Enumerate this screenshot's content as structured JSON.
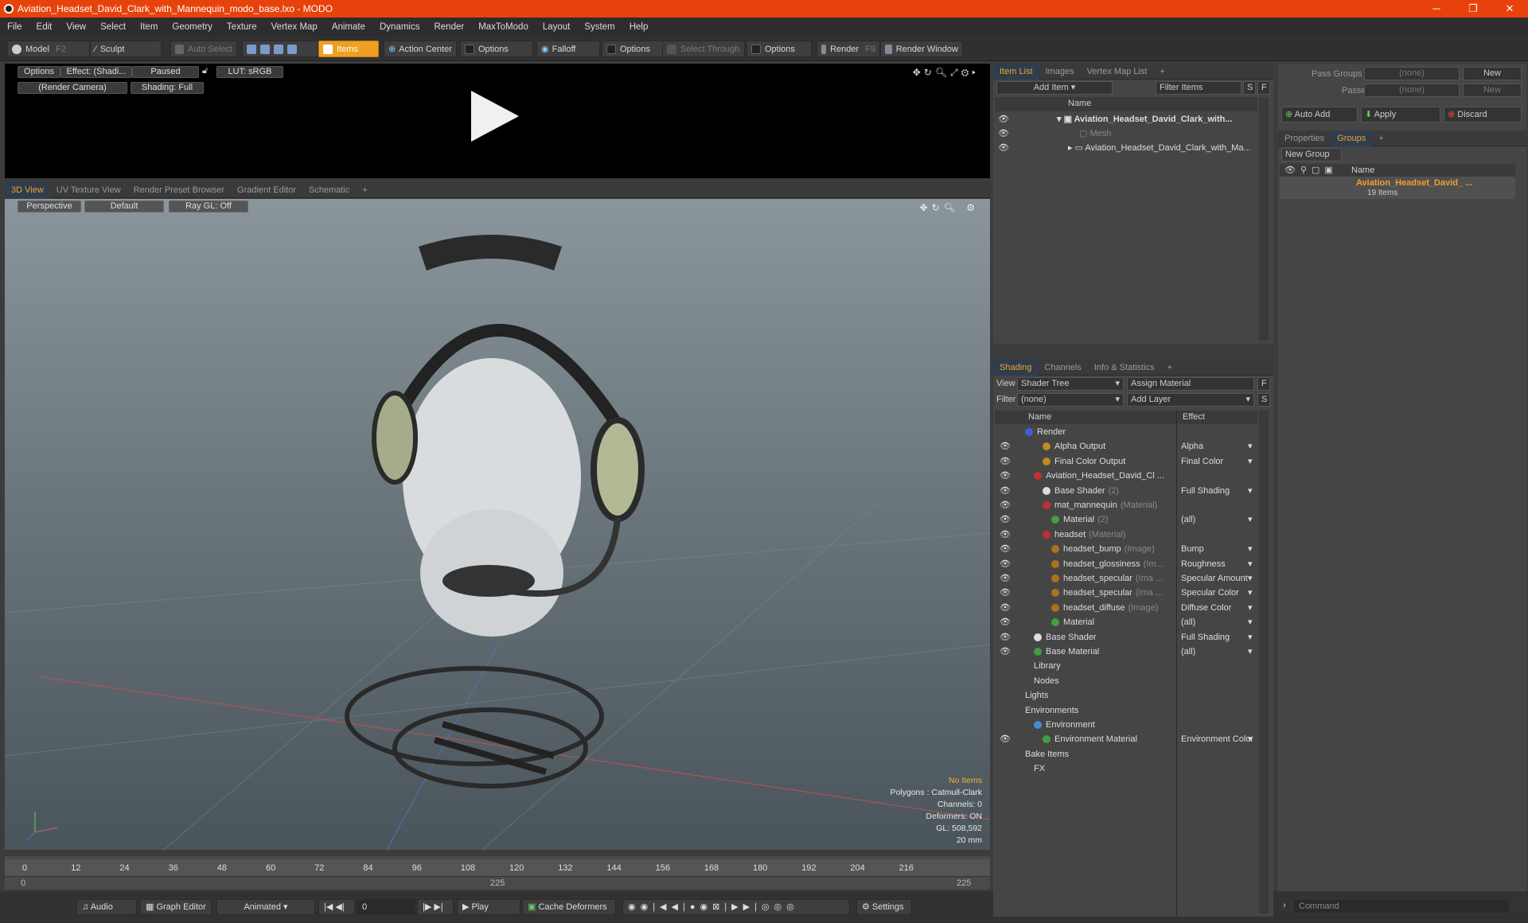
{
  "window": {
    "title": "Aviation_Headset_David_Clark_with_Mannequin_modo_base.lxo - MODO",
    "min": "─",
    "max": "❐",
    "close": "✕"
  },
  "menu": [
    "File",
    "Edit",
    "View",
    "Select",
    "Item",
    "Geometry",
    "Texture",
    "Vertex Map",
    "Animate",
    "Dynamics",
    "Render",
    "MaxToModo",
    "Layout",
    "System",
    "Help"
  ],
  "toolbar": {
    "model": "Model",
    "model_key": "F2",
    "sculpt": "Sculpt",
    "auto_select": "Auto Select",
    "items": "Items",
    "action_center": "Action Center",
    "options1": "Options",
    "falloff": "Falloff",
    "options2": "Options",
    "select_through": "Select Through",
    "options3": "Options",
    "render": "Render",
    "render_key": "F9",
    "render_window": "Render Window"
  },
  "preview": {
    "options": "Options",
    "effect": "Effect: (Shadi...",
    "paused": "Paused",
    "lut": "LUT: sRGB",
    "camera": "(Render Camera)",
    "shading": "Shading: Full"
  },
  "viewtabs": [
    "3D View",
    "UV Texture View",
    "Render Preset Browser",
    "Gradient Editor",
    "Schematic",
    "+"
  ],
  "viewport": {
    "perspective": "Perspective",
    "default": "Default",
    "raygl": "Ray GL: Off",
    "hud": {
      "no_items": "No Items",
      "polygons": "Polygons : Catmull-Clark",
      "channels": "Channels: 0",
      "deformers": "Deformers: ON",
      "gl": "GL: 508,592",
      "mm": "20 mm"
    }
  },
  "timeline": {
    "ticks": [
      "0",
      "12",
      "24",
      "36",
      "48",
      "60",
      "72",
      "84",
      "96",
      "108",
      "120",
      "132",
      "144",
      "156",
      "168",
      "180",
      "192",
      "204",
      "216"
    ],
    "start": "0",
    "mid": "225",
    "end": "225"
  },
  "bottom": {
    "audio": "Audio",
    "graph_editor": "Graph Editor",
    "animated": "Animated",
    "frame": "0",
    "play": "Play",
    "cache": "Cache Deformers",
    "settings": "Settings"
  },
  "itemlist": {
    "tabs": [
      "Item List",
      "Images",
      "Vertex Map List",
      "+"
    ],
    "add_item": "Add Item",
    "filter": "Filter Items",
    "s": "S",
    "f": "F",
    "col_name": "Name",
    "rows": [
      "Aviation_Headset_David_Clark_with...",
      "Mesh",
      "Aviation_Headset_David_Clark_with_Ma..."
    ]
  },
  "shading": {
    "tabs": [
      "Shading",
      "Channels",
      "Info & Statistics",
      "+"
    ],
    "view_label": "View",
    "view_value": "Shader Tree",
    "assign": "Assign Material",
    "f": "F",
    "filter_label": "Filter",
    "filter_value": "(none)",
    "add_layer": "Add Layer",
    "s": "S",
    "col_name": "Name",
    "col_effect": "Effect",
    "rows": [
      {
        "name": "Render",
        "sub": "",
        "effect": "",
        "indent": 0,
        "eye": false,
        "dot": "#4a5ad0"
      },
      {
        "name": "Alpha Output",
        "sub": "",
        "effect": "Alpha",
        "indent": 2,
        "eye": true,
        "dot": "#c08a20"
      },
      {
        "name": "Final Color Output",
        "sub": "",
        "effect": "Final Color",
        "indent": 2,
        "eye": true,
        "dot": "#c08a20"
      },
      {
        "name": "Aviation_Headset_David_Cl ...",
        "sub": "",
        "effect": "",
        "indent": 1,
        "eye": true,
        "dot": "#c03030"
      },
      {
        "name": "Base Shader",
        "sub": "(2)",
        "effect": "Full Shading",
        "indent": 2,
        "eye": true,
        "dot": "#dddddd"
      },
      {
        "name": "mat_mannequin",
        "sub": "(Material)",
        "effect": "",
        "indent": 2,
        "eye": true,
        "dot": "#c03030"
      },
      {
        "name": "Material",
        "sub": "(2)",
        "effect": "(all)",
        "indent": 3,
        "eye": true,
        "dot": "#40a040"
      },
      {
        "name": "headset",
        "sub": "(Material)",
        "effect": "",
        "indent": 2,
        "eye": true,
        "dot": "#c03030"
      },
      {
        "name": "headset_bump",
        "sub": "(Image)",
        "effect": "Bump",
        "indent": 3,
        "eye": true,
        "dot": "#b07020"
      },
      {
        "name": "headset_glossiness",
        "sub": "(Im...",
        "effect": "Roughness",
        "indent": 3,
        "eye": true,
        "dot": "#b07020"
      },
      {
        "name": "headset_specular",
        "sub": "(Ima ...",
        "effect": "Specular Amount",
        "indent": 3,
        "eye": true,
        "dot": "#b07020"
      },
      {
        "name": "headset_specular",
        "sub": "(Ima ...",
        "effect": "Specular Color",
        "indent": 3,
        "eye": true,
        "dot": "#b07020"
      },
      {
        "name": "headset_diffuse",
        "sub": "(Image)",
        "effect": "Diffuse Color",
        "indent": 3,
        "eye": true,
        "dot": "#b07020"
      },
      {
        "name": "Material",
        "sub": "",
        "effect": "(all)",
        "indent": 3,
        "eye": true,
        "dot": "#40a040"
      },
      {
        "name": "Base Shader",
        "sub": "",
        "effect": "Full Shading",
        "indent": 1,
        "eye": true,
        "dot": "#dddddd"
      },
      {
        "name": "Base Material",
        "sub": "",
        "effect": "(all)",
        "indent": 1,
        "eye": true,
        "dot": "#40a040"
      },
      {
        "name": "Library",
        "sub": "",
        "effect": "",
        "indent": 1,
        "eye": false,
        "dot": ""
      },
      {
        "name": "Nodes",
        "sub": "",
        "effect": "",
        "indent": 1,
        "eye": false,
        "dot": ""
      },
      {
        "name": "Lights",
        "sub": "",
        "effect": "",
        "indent": 0,
        "eye": false,
        "dot": ""
      },
      {
        "name": "Environments",
        "sub": "",
        "effect": "",
        "indent": 0,
        "eye": false,
        "dot": ""
      },
      {
        "name": "Environment",
        "sub": "",
        "effect": "",
        "indent": 1,
        "eye": false,
        "dot": "#4a8ad0"
      },
      {
        "name": "Environment Material",
        "sub": "",
        "effect": "Environment Color",
        "indent": 2,
        "eye": true,
        "dot": "#40a040"
      },
      {
        "name": "Bake Items",
        "sub": "",
        "effect": "",
        "indent": 0,
        "eye": false,
        "dot": ""
      },
      {
        "name": "FX",
        "sub": "",
        "effect": "",
        "indent": 1,
        "eye": false,
        "dot": ""
      }
    ]
  },
  "right": {
    "pass_groups": "Pass Groups",
    "passes": "Passes",
    "none1": "(none)",
    "none2": "(none)",
    "new1": "New",
    "new2": "New",
    "auto_add": "Auto Add",
    "apply": "Apply",
    "discard": "Discard",
    "tabs": [
      "Properties",
      "Groups",
      "+"
    ],
    "new_group": "New Group",
    "col_name": "Name",
    "group_name": "Aviation_Headset_David_ ...",
    "group_count": "19 Items",
    "command": "Command"
  }
}
